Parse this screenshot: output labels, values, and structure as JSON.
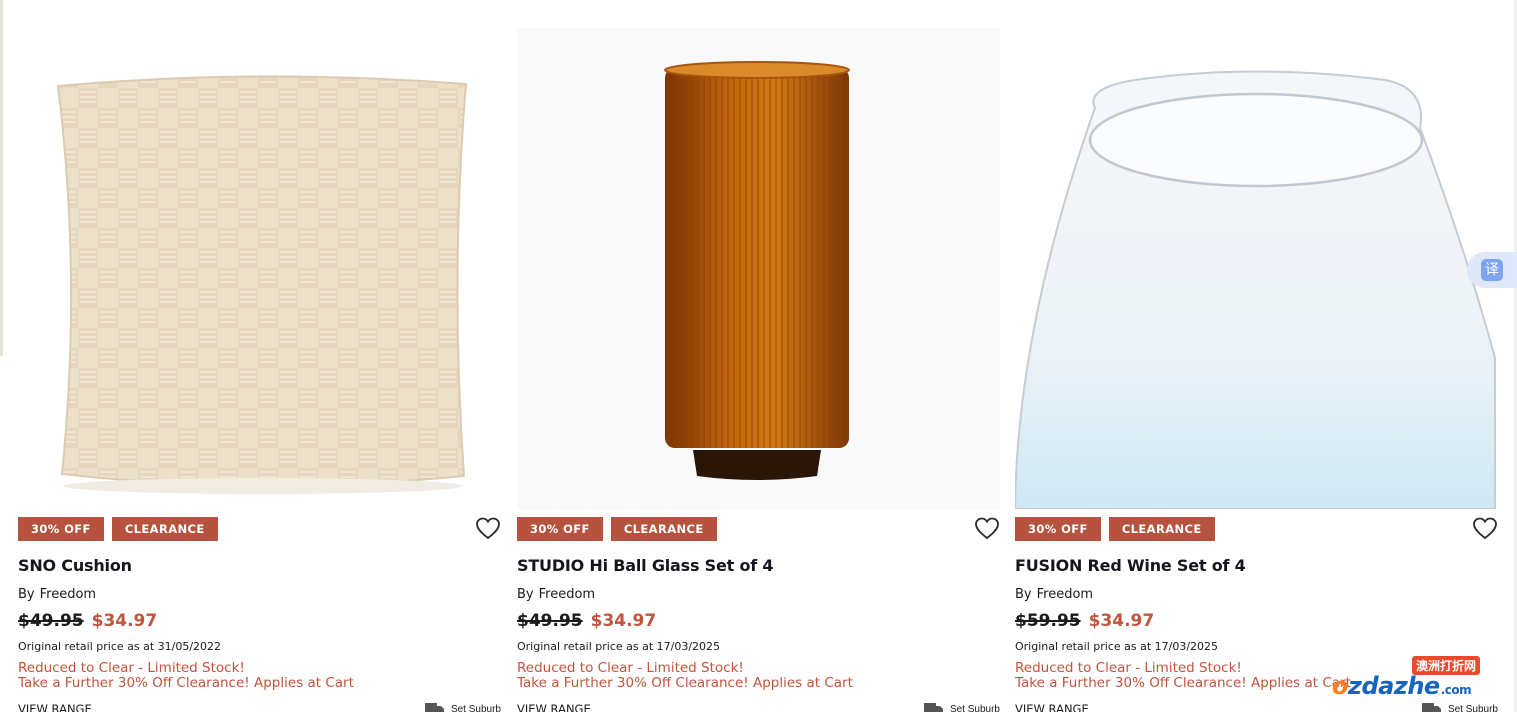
{
  "products": [
    {
      "image_alt": "SNO Cushion",
      "badges": [
        "30% OFF",
        "CLEARANCE"
      ],
      "title": "SNO Cushion",
      "by_label": "By",
      "brand": "Freedom",
      "was_price": "$49.95",
      "now_price": "$34.97",
      "original_note": "Original retail price as at 31/05/2022",
      "promo_line1": "Reduced to Clear - Limited Stock!",
      "promo_line2": "Take a Further 30% Off Clearance! Applies at Cart",
      "view_range": "VIEW RANGE",
      "set_suburb": "Set Suburb"
    },
    {
      "image_alt": "STUDIO Hi Ball Glass Set of 4",
      "badges": [
        "30% OFF",
        "CLEARANCE"
      ],
      "title": "STUDIO Hi Ball Glass Set of 4",
      "by_label": "By",
      "brand": "Freedom",
      "was_price": "$49.95",
      "now_price": "$34.97",
      "original_note": "Original retail price as at 17/03/2025",
      "promo_line1": "Reduced to Clear - Limited Stock!",
      "promo_line2": "Take a Further 30% Off Clearance! Applies at Cart",
      "view_range": "VIEW RANGE",
      "set_suburb": "Set Suburb"
    },
    {
      "image_alt": "FUSION Red Wine Set of 4",
      "badges": [
        "30% OFF",
        "CLEARANCE"
      ],
      "title": "FUSION Red Wine Set of 4",
      "by_label": "By",
      "brand": "Freedom",
      "was_price": "$59.95",
      "now_price": "$34.97",
      "original_note": "Original retail price as at 17/03/2025",
      "promo_line1": "Reduced to Clear - Limited Stock!",
      "promo_line2": "Take a Further 30% Off Clearance! Applies at Cart",
      "view_range": "VIEW RANGE",
      "set_suburb": "Set Suburb"
    }
  ],
  "translate_widget": {
    "label": "译",
    "icon": "translate-icon"
  },
  "watermark": {
    "tag": "澳洲打折网",
    "o": "o",
    "main": "zdazhe",
    "tld": ".com"
  },
  "colors": {
    "badge_bg": "#b5533e",
    "sale_price": "#c0543c",
    "promo_text": "#c0543c",
    "title_text": "#15161d"
  },
  "icons": [
    "heart-outline-icon",
    "delivery-truck-icon",
    "translate-icon"
  ]
}
